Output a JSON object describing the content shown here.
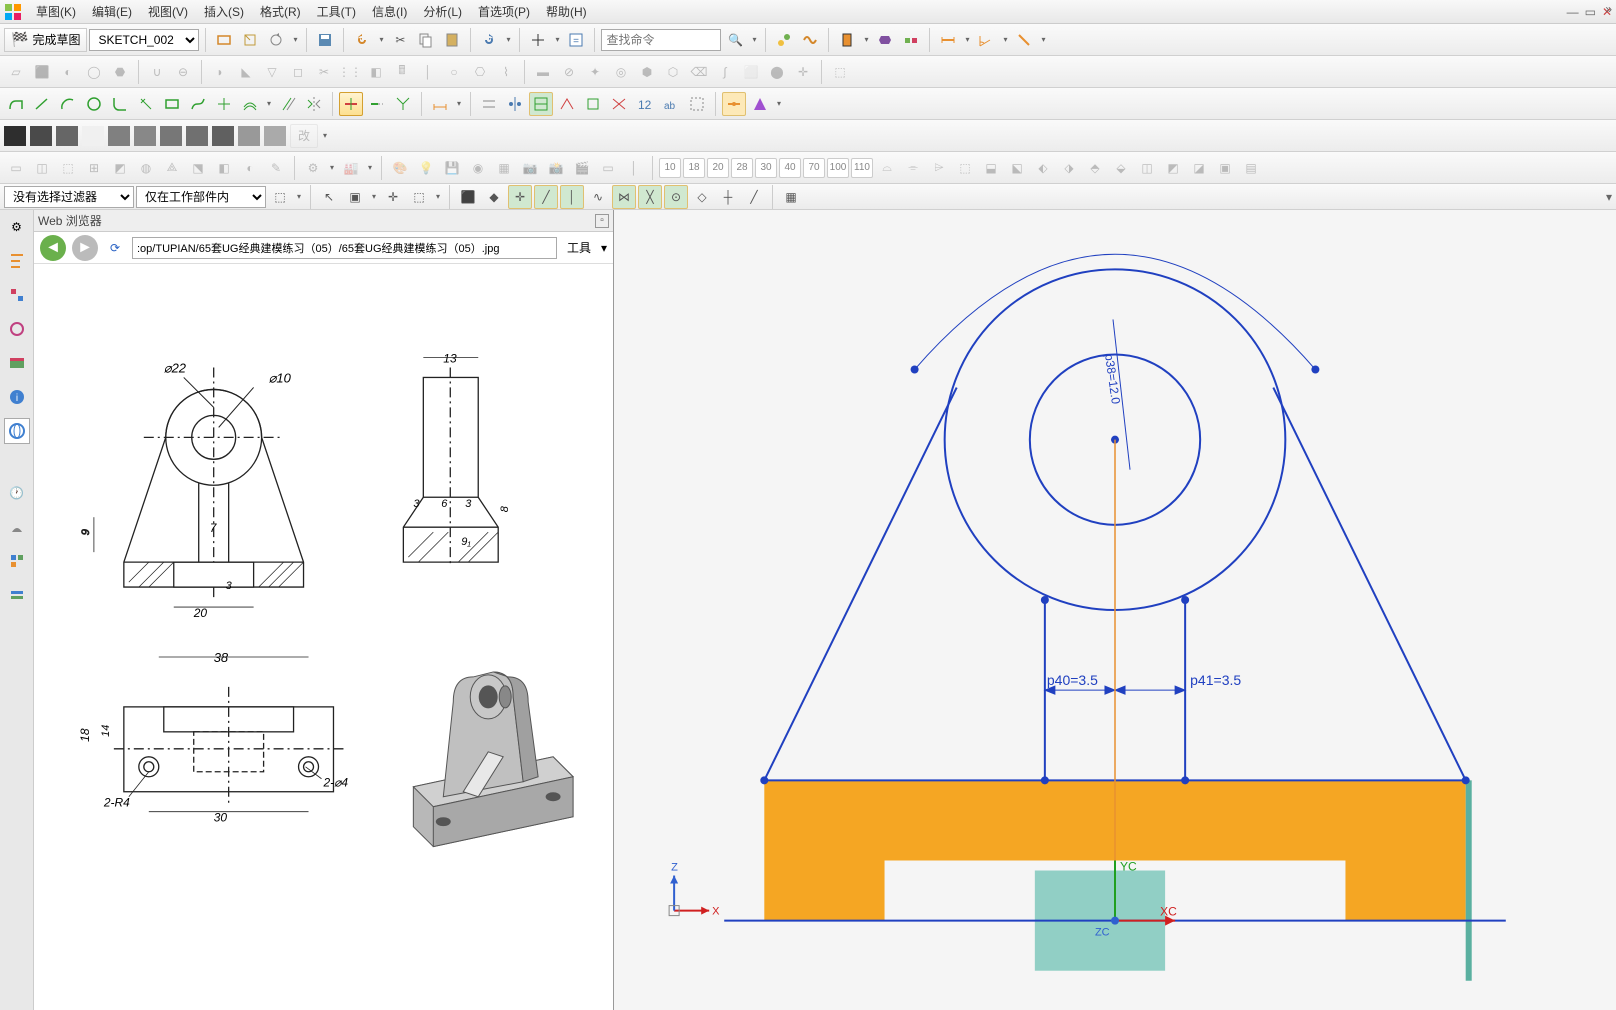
{
  "menu": {
    "items": [
      "草图(K)",
      "编辑(E)",
      "视图(V)",
      "插入(S)",
      "格式(R)",
      "工具(T)",
      "信息(I)",
      "分析(L)",
      "首选项(P)",
      "帮助(H)"
    ]
  },
  "toolbar1": {
    "finish_label": "完成草图",
    "sketch_name": "SKETCH_002",
    "search_placeholder": "查找命令"
  },
  "filters": {
    "no_filter": "没有选择过滤器",
    "scope": "仅在工作部件内"
  },
  "numeric_buttons": [
    "10",
    "18",
    "20",
    "28",
    "30",
    "40",
    "70",
    "100",
    "110"
  ],
  "gray_swatches": [
    "#2e2e2e",
    "#4a4a4a",
    "#666666",
    "#808080",
    "#999999",
    "#777777",
    "#888888",
    "#707070",
    "#606060",
    "#aaaaaa",
    "#bbbbbb"
  ],
  "browser": {
    "title": "Web 浏览器",
    "url": ":op/TUPIAN/65套UG经典建模练习（05）/65套UG经典建模练习（05）.jpg",
    "tools_label": "工具"
  },
  "drawing": {
    "dim_d22": "⌀22",
    "dim_d10": "⌀10",
    "dim_13": "13",
    "dim_7": "7",
    "dim_3a": "3",
    "dim_6": "6",
    "dim_3b": "3",
    "dim_8": "8",
    "dim_9": "9",
    "dim_91": "9₁",
    "dim_20": "20",
    "dim_3c": "3",
    "dim_38": "38",
    "dim_18": "18",
    "dim_14": "14",
    "dim_30": "30",
    "dim_2r4": "2-R4",
    "dim_2d4": "2-⌀4"
  },
  "sketch": {
    "dim_p40": "p40=3.5",
    "dim_p41": "p41=3.5",
    "dim_p38": "p38=12.0",
    "axis_z": "Z",
    "axis_x": "X",
    "axis_xc": "XC",
    "axis_yc": "YC",
    "axis_zc": "ZC"
  }
}
